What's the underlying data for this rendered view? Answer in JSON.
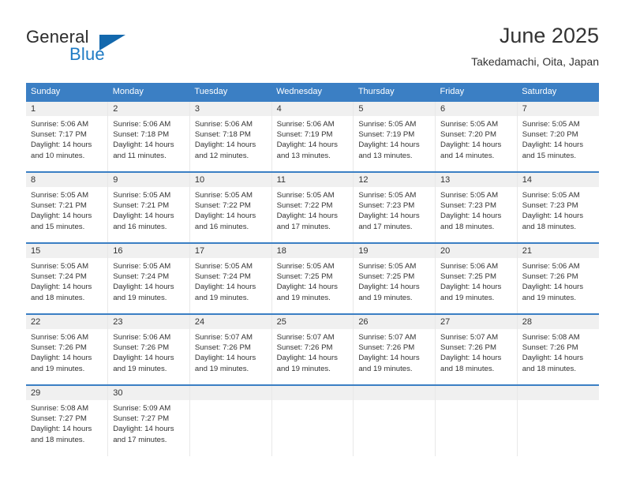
{
  "brand": {
    "name_part1": "General",
    "name_part2": "Blue",
    "triangle_color": "#1368ad",
    "blue_color": "#1f7bc4"
  },
  "header": {
    "title": "June 2025",
    "subtitle": "Takedamachi, Oita, Japan"
  },
  "theme": {
    "header_bg": "#3b7fc4",
    "header_text": "#ffffff",
    "daynum_bg": "#f0f0f0",
    "row_divider": "#3b7fc4"
  },
  "weekdays": [
    "Sunday",
    "Monday",
    "Tuesday",
    "Wednesday",
    "Thursday",
    "Friday",
    "Saturday"
  ],
  "weeks": [
    [
      {
        "day": "1",
        "lines": [
          "Sunrise: 5:06 AM",
          "Sunset: 7:17 PM",
          "Daylight: 14 hours",
          "and 10 minutes."
        ]
      },
      {
        "day": "2",
        "lines": [
          "Sunrise: 5:06 AM",
          "Sunset: 7:18 PM",
          "Daylight: 14 hours",
          "and 11 minutes."
        ]
      },
      {
        "day": "3",
        "lines": [
          "Sunrise: 5:06 AM",
          "Sunset: 7:18 PM",
          "Daylight: 14 hours",
          "and 12 minutes."
        ]
      },
      {
        "day": "4",
        "lines": [
          "Sunrise: 5:06 AM",
          "Sunset: 7:19 PM",
          "Daylight: 14 hours",
          "and 13 minutes."
        ]
      },
      {
        "day": "5",
        "lines": [
          "Sunrise: 5:05 AM",
          "Sunset: 7:19 PM",
          "Daylight: 14 hours",
          "and 13 minutes."
        ]
      },
      {
        "day": "6",
        "lines": [
          "Sunrise: 5:05 AM",
          "Sunset: 7:20 PM",
          "Daylight: 14 hours",
          "and 14 minutes."
        ]
      },
      {
        "day": "7",
        "lines": [
          "Sunrise: 5:05 AM",
          "Sunset: 7:20 PM",
          "Daylight: 14 hours",
          "and 15 minutes."
        ]
      }
    ],
    [
      {
        "day": "8",
        "lines": [
          "Sunrise: 5:05 AM",
          "Sunset: 7:21 PM",
          "Daylight: 14 hours",
          "and 15 minutes."
        ]
      },
      {
        "day": "9",
        "lines": [
          "Sunrise: 5:05 AM",
          "Sunset: 7:21 PM",
          "Daylight: 14 hours",
          "and 16 minutes."
        ]
      },
      {
        "day": "10",
        "lines": [
          "Sunrise: 5:05 AM",
          "Sunset: 7:22 PM",
          "Daylight: 14 hours",
          "and 16 minutes."
        ]
      },
      {
        "day": "11",
        "lines": [
          "Sunrise: 5:05 AM",
          "Sunset: 7:22 PM",
          "Daylight: 14 hours",
          "and 17 minutes."
        ]
      },
      {
        "day": "12",
        "lines": [
          "Sunrise: 5:05 AM",
          "Sunset: 7:23 PM",
          "Daylight: 14 hours",
          "and 17 minutes."
        ]
      },
      {
        "day": "13",
        "lines": [
          "Sunrise: 5:05 AM",
          "Sunset: 7:23 PM",
          "Daylight: 14 hours",
          "and 18 minutes."
        ]
      },
      {
        "day": "14",
        "lines": [
          "Sunrise: 5:05 AM",
          "Sunset: 7:23 PM",
          "Daylight: 14 hours",
          "and 18 minutes."
        ]
      }
    ],
    [
      {
        "day": "15",
        "lines": [
          "Sunrise: 5:05 AM",
          "Sunset: 7:24 PM",
          "Daylight: 14 hours",
          "and 18 minutes."
        ]
      },
      {
        "day": "16",
        "lines": [
          "Sunrise: 5:05 AM",
          "Sunset: 7:24 PM",
          "Daylight: 14 hours",
          "and 19 minutes."
        ]
      },
      {
        "day": "17",
        "lines": [
          "Sunrise: 5:05 AM",
          "Sunset: 7:24 PM",
          "Daylight: 14 hours",
          "and 19 minutes."
        ]
      },
      {
        "day": "18",
        "lines": [
          "Sunrise: 5:05 AM",
          "Sunset: 7:25 PM",
          "Daylight: 14 hours",
          "and 19 minutes."
        ]
      },
      {
        "day": "19",
        "lines": [
          "Sunrise: 5:05 AM",
          "Sunset: 7:25 PM",
          "Daylight: 14 hours",
          "and 19 minutes."
        ]
      },
      {
        "day": "20",
        "lines": [
          "Sunrise: 5:06 AM",
          "Sunset: 7:25 PM",
          "Daylight: 14 hours",
          "and 19 minutes."
        ]
      },
      {
        "day": "21",
        "lines": [
          "Sunrise: 5:06 AM",
          "Sunset: 7:26 PM",
          "Daylight: 14 hours",
          "and 19 minutes."
        ]
      }
    ],
    [
      {
        "day": "22",
        "lines": [
          "Sunrise: 5:06 AM",
          "Sunset: 7:26 PM",
          "Daylight: 14 hours",
          "and 19 minutes."
        ]
      },
      {
        "day": "23",
        "lines": [
          "Sunrise: 5:06 AM",
          "Sunset: 7:26 PM",
          "Daylight: 14 hours",
          "and 19 minutes."
        ]
      },
      {
        "day": "24",
        "lines": [
          "Sunrise: 5:07 AM",
          "Sunset: 7:26 PM",
          "Daylight: 14 hours",
          "and 19 minutes."
        ]
      },
      {
        "day": "25",
        "lines": [
          "Sunrise: 5:07 AM",
          "Sunset: 7:26 PM",
          "Daylight: 14 hours",
          "and 19 minutes."
        ]
      },
      {
        "day": "26",
        "lines": [
          "Sunrise: 5:07 AM",
          "Sunset: 7:26 PM",
          "Daylight: 14 hours",
          "and 19 minutes."
        ]
      },
      {
        "day": "27",
        "lines": [
          "Sunrise: 5:07 AM",
          "Sunset: 7:26 PM",
          "Daylight: 14 hours",
          "and 18 minutes."
        ]
      },
      {
        "day": "28",
        "lines": [
          "Sunrise: 5:08 AM",
          "Sunset: 7:26 PM",
          "Daylight: 14 hours",
          "and 18 minutes."
        ]
      }
    ],
    [
      {
        "day": "29",
        "lines": [
          "Sunrise: 5:08 AM",
          "Sunset: 7:27 PM",
          "Daylight: 14 hours",
          "and 18 minutes."
        ]
      },
      {
        "day": "30",
        "lines": [
          "Sunrise: 5:09 AM",
          "Sunset: 7:27 PM",
          "Daylight: 14 hours",
          "and 17 minutes."
        ]
      },
      {
        "day": "",
        "lines": []
      },
      {
        "day": "",
        "lines": []
      },
      {
        "day": "",
        "lines": []
      },
      {
        "day": "",
        "lines": []
      },
      {
        "day": "",
        "lines": []
      }
    ]
  ]
}
